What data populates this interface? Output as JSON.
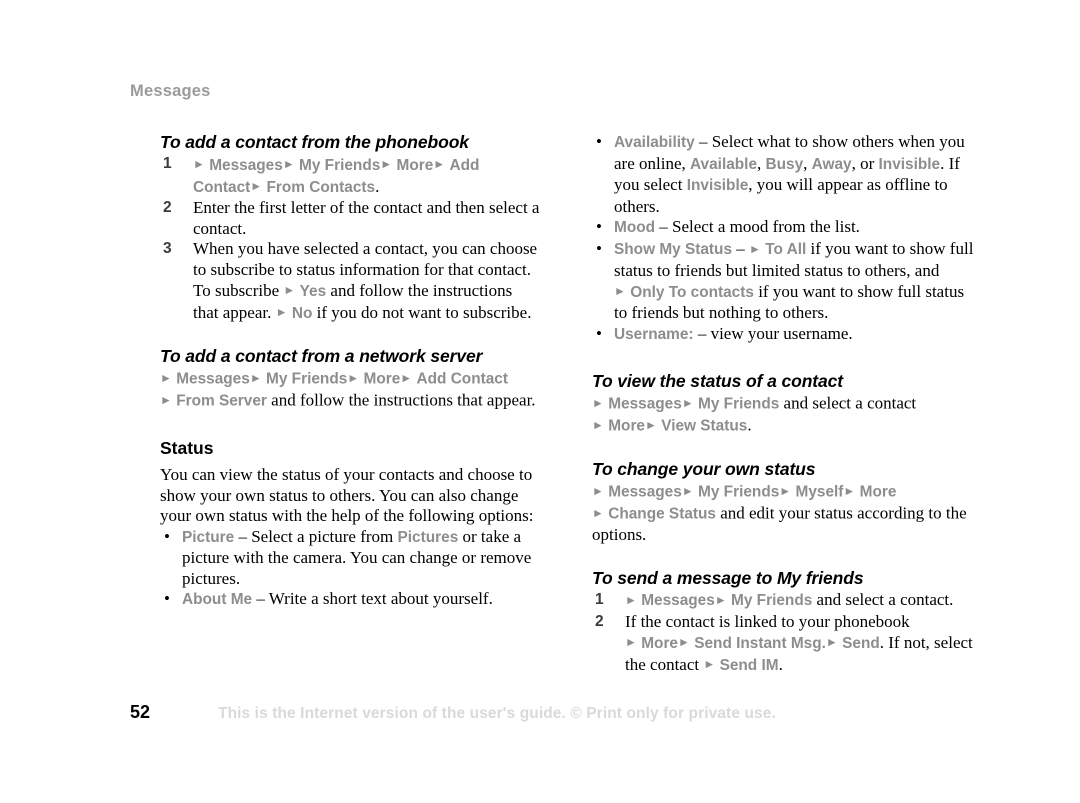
{
  "page": {
    "running_header": "Messages",
    "number": "52",
    "footer_note": "This is the Internet version of the user's guide. © Print only for private use.",
    "arrow_glyph": "►",
    "bullet_glyph": "•"
  },
  "colors": {
    "ui_term_gray": "#8d8d8d",
    "header_gray": "#9a9a9a",
    "footer_gray": "#d9d9d9",
    "body_black": "#000000",
    "step_number": "#3c3c3c"
  },
  "left_column": {
    "section_phonebook": {
      "heading": "To add a contact from the phonebook",
      "steps": [
        {
          "number": "1",
          "parts": [
            {
              "t": "arrow"
            },
            {
              "t": "ui",
              "v": "Messages"
            },
            {
              "t": "arrow"
            },
            {
              "t": "ui",
              "v": "My Friends"
            },
            {
              "t": "arrow"
            },
            {
              "t": "ui",
              "v": "More"
            },
            {
              "t": "arrow"
            },
            {
              "t": "ui",
              "v": "Add Contact"
            },
            {
              "t": "arrow"
            },
            {
              "t": "ui",
              "v": "From Contacts"
            },
            {
              "t": "text",
              "v": "."
            }
          ]
        },
        {
          "number": "2",
          "parts": [
            {
              "t": "text",
              "v": "Enter the first letter of the contact and then select a contact."
            }
          ]
        },
        {
          "number": "3",
          "parts": [
            {
              "t": "text",
              "v": "When you have selected a contact, you can choose to subscribe to status information for that contact. To subscribe "
            },
            {
              "t": "arrow"
            },
            {
              "t": "ui",
              "v": "Yes"
            },
            {
              "t": "text",
              "v": " and follow the instructions that appear. "
            },
            {
              "t": "arrow"
            },
            {
              "t": "ui",
              "v": "No"
            },
            {
              "t": "text",
              "v": " if you do not want to subscribe."
            }
          ]
        }
      ]
    },
    "section_network_server": {
      "heading": "To add a contact from a network server",
      "path": [
        {
          "t": "arrow"
        },
        {
          "t": "ui",
          "v": "Messages"
        },
        {
          "t": "arrow"
        },
        {
          "t": "ui",
          "v": "My Friends"
        },
        {
          "t": "arrow"
        },
        {
          "t": "ui",
          "v": "More"
        },
        {
          "t": "arrow"
        },
        {
          "t": "ui",
          "v": "Add Contact"
        },
        {
          "t": "break"
        },
        {
          "t": "arrow"
        },
        {
          "t": "ui",
          "v": "From Server"
        },
        {
          "t": "text",
          "v": " and follow the instructions that appear."
        }
      ]
    },
    "section_status": {
      "heading": "Status",
      "intro": "You can view the status of your contacts and choose to show your own status to others. You can also change your own status with the help of the following options:",
      "bullets": [
        [
          {
            "t": "ui",
            "v": "Picture"
          },
          {
            "t": "text",
            "v": " – Select a picture from "
          },
          {
            "t": "ui",
            "v": "Pictures"
          },
          {
            "t": "text",
            "v": " or take a picture with the camera. You can change or remove pictures."
          }
        ],
        [
          {
            "t": "ui",
            "v": "About Me"
          },
          {
            "t": "text",
            "v": " – Write a short text about yourself."
          }
        ]
      ]
    }
  },
  "right_column": {
    "status_options_bullets": [
      [
        {
          "t": "ui",
          "v": "Availability"
        },
        {
          "t": "text",
          "v": " – Select what to show others when you are online, "
        },
        {
          "t": "ui",
          "v": "Available"
        },
        {
          "t": "text",
          "v": ", "
        },
        {
          "t": "ui",
          "v": "Busy"
        },
        {
          "t": "text",
          "v": ", "
        },
        {
          "t": "ui",
          "v": "Away"
        },
        {
          "t": "text",
          "v": ", or "
        },
        {
          "t": "ui",
          "v": "Invisible"
        },
        {
          "t": "text",
          "v": ". If you select "
        },
        {
          "t": "ui",
          "v": "Invisible"
        },
        {
          "t": "text",
          "v": ", you will appear as offline to others."
        }
      ],
      [
        {
          "t": "ui",
          "v": "Mood"
        },
        {
          "t": "text",
          "v": " – Select a mood from the list."
        }
      ],
      [
        {
          "t": "ui",
          "v": "Show My Status"
        },
        {
          "t": "text",
          "v": " – "
        },
        {
          "t": "arrow"
        },
        {
          "t": "ui",
          "v": "To All"
        },
        {
          "t": "text",
          "v": " if you want to show full status to friends but limited status to others, and "
        },
        {
          "t": "arrow"
        },
        {
          "t": "ui",
          "v": "Only To contacts"
        },
        {
          "t": "text",
          "v": " if you want to show full status to friends but nothing to others."
        }
      ],
      [
        {
          "t": "ui",
          "v": "Username:"
        },
        {
          "t": "text",
          "v": " – view your username."
        }
      ]
    ],
    "section_view_status": {
      "heading": "To view the status of a contact",
      "path": [
        {
          "t": "arrow"
        },
        {
          "t": "ui",
          "v": "Messages"
        },
        {
          "t": "arrow"
        },
        {
          "t": "ui",
          "v": "My Friends"
        },
        {
          "t": "text",
          "v": " and select a contact"
        },
        {
          "t": "break"
        },
        {
          "t": "arrow"
        },
        {
          "t": "ui",
          "v": "More"
        },
        {
          "t": "arrow"
        },
        {
          "t": "ui",
          "v": "View Status"
        },
        {
          "t": "text",
          "v": "."
        }
      ]
    },
    "section_change_status": {
      "heading": "To change your own status",
      "path": [
        {
          "t": "arrow"
        },
        {
          "t": "ui",
          "v": "Messages"
        },
        {
          "t": "arrow"
        },
        {
          "t": "ui",
          "v": "My Friends"
        },
        {
          "t": "arrow"
        },
        {
          "t": "ui",
          "v": "Myself"
        },
        {
          "t": "arrow"
        },
        {
          "t": "ui",
          "v": "More"
        },
        {
          "t": "break"
        },
        {
          "t": "arrow"
        },
        {
          "t": "ui",
          "v": "Change Status"
        },
        {
          "t": "text",
          "v": " and edit your status according to the options."
        }
      ]
    },
    "section_send_message": {
      "heading": "To send a message to My friends",
      "steps": [
        {
          "number": "1",
          "parts": [
            {
              "t": "arrow"
            },
            {
              "t": "ui",
              "v": "Messages"
            },
            {
              "t": "arrow"
            },
            {
              "t": "ui",
              "v": "My Friends"
            },
            {
              "t": "text",
              "v": " and select a contact."
            }
          ]
        },
        {
          "number": "2",
          "parts": [
            {
              "t": "text",
              "v": "If the contact is linked to your phonebook "
            },
            {
              "t": "arrow"
            },
            {
              "t": "ui",
              "v": "More"
            },
            {
              "t": "arrow"
            },
            {
              "t": "ui",
              "v": "Send Instant Msg."
            },
            {
              "t": "arrow"
            },
            {
              "t": "ui",
              "v": "Send"
            },
            {
              "t": "text",
              "v": ". If not, select the contact "
            },
            {
              "t": "arrow"
            },
            {
              "t": "ui",
              "v": "Send IM"
            },
            {
              "t": "text",
              "v": "."
            }
          ]
        }
      ]
    }
  }
}
